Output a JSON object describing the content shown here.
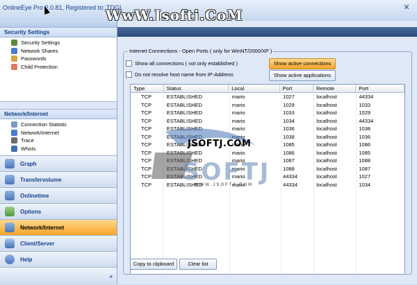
{
  "window": {
    "title": "OnlineEye Pro 2.0.81, Registered to: TDGI",
    "watermark": "WwW.Jsoftj.CoM"
  },
  "sidebar": {
    "security_section": {
      "title": "Security Settings",
      "items": [
        {
          "label": "Security Settings",
          "icon": "security-icon"
        },
        {
          "label": "Network Shares",
          "icon": "share-icon"
        },
        {
          "label": "Passwords",
          "icon": "key-icon"
        },
        {
          "label": "Child Protection",
          "icon": "child-icon"
        }
      ]
    },
    "network_section": {
      "title": "Network/Internet",
      "items": [
        {
          "label": "Connection Statistic",
          "icon": "statistic-icon"
        },
        {
          "label": "Network/Internet",
          "icon": "network-icon"
        },
        {
          "label": "Trace",
          "icon": "trace-icon"
        },
        {
          "label": "WhoIs",
          "icon": "whois-icon"
        }
      ]
    },
    "nav": [
      {
        "label": "Graph",
        "icon": "graph-icon"
      },
      {
        "label": "Transfervolume",
        "icon": "transfer-icon"
      },
      {
        "label": "Onlinetime",
        "icon": "clock-icon"
      },
      {
        "label": "Options",
        "icon": "options-icon"
      },
      {
        "label": "Network/Internet",
        "icon": "network-icon",
        "active": true
      },
      {
        "label": "Client/Server",
        "icon": "server-icon"
      },
      {
        "label": "Help",
        "icon": "help-icon"
      }
    ],
    "expand_glyph": "»"
  },
  "main": {
    "group_title": "Internet Connections - Open Ports ( only for WinNT/2000/XP )",
    "show_all_label": "Show all connections ( not only established )",
    "no_resolve_label": "Do not resolve host name from IP-Address",
    "btn_active_connections": "Show active connections",
    "btn_active_applications": "Show active applications",
    "columns": [
      "Type",
      "Status",
      "Local",
      "Port",
      "Remote",
      "Port"
    ],
    "rows": [
      [
        "TCP",
        "ESTABLISHED",
        "mario",
        "1027",
        "localhost",
        "44334"
      ],
      [
        "TCP",
        "ESTABLISHED",
        "mario",
        "1029",
        "localhost",
        "1033"
      ],
      [
        "TCP",
        "ESTABLISHED",
        "mario",
        "1033",
        "localhost",
        "1029"
      ],
      [
        "TCP",
        "ESTABLISHED",
        "mario",
        "1034",
        "localhost",
        "44334"
      ],
      [
        "TCP",
        "ESTABLISHED",
        "mario",
        "1036",
        "localhost",
        "1038"
      ],
      [
        "TCP",
        "ESTABLISHED",
        "mario",
        "1038",
        "localhost",
        "1036"
      ],
      [
        "TCP",
        "ESTABLISHED",
        "mario",
        "1085",
        "localhost",
        "1086"
      ],
      [
        "TCP",
        "ESTABLISHED",
        "mario",
        "1086",
        "localhost",
        "1085"
      ],
      [
        "TCP",
        "ESTABLISHED",
        "mario",
        "1087",
        "localhost",
        "1088"
      ],
      [
        "TCP",
        "ESTABLISHED",
        "mario",
        "1088",
        "localhost",
        "1087"
      ],
      [
        "TCP",
        "ESTABLISHED",
        "mario",
        "44334",
        "localhost",
        "1027"
      ],
      [
        "TCP",
        "ESTABLISHED",
        "mario",
        "44334",
        "localhost",
        "1034"
      ]
    ],
    "btn_copy": "Copy to clipboard",
    "btn_clear": "Clear list"
  },
  "overlay_logo": {
    "text": "JSOFTJ.COM",
    "big": "SOFTJ",
    "url": "WWW.JSOFTJ.COM"
  },
  "colors": {
    "accent": "#f8a529",
    "title_text": "#15428b",
    "panel": "#dfe8f6"
  }
}
